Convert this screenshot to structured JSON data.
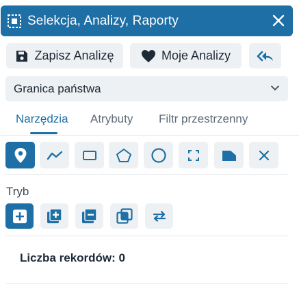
{
  "header": {
    "title": "Selekcja, Analizy, Raporty",
    "icon": "selection-frame-icon",
    "close_icon": "close-icon"
  },
  "actions": {
    "save_label": "Zapisz Analizę",
    "my_label": "Moje Analizy",
    "save_icon": "floppy-disk-icon",
    "my_icon": "heart-icon",
    "back_icon": "reply-all-icon"
  },
  "dropdown": {
    "value": "Granica państwa"
  },
  "tabs": [
    {
      "label": "Narzędzia",
      "active": true
    },
    {
      "label": "Atrybuty",
      "active": false
    },
    {
      "label": "Filtr przestrzenny",
      "active": false
    }
  ],
  "tools": [
    {
      "icon": "map-pin-icon",
      "active": true
    },
    {
      "icon": "polyline-icon",
      "active": false
    },
    {
      "icon": "rectangle-icon",
      "active": false
    },
    {
      "icon": "pentagon-icon",
      "active": false
    },
    {
      "icon": "circle-icon",
      "active": false
    },
    {
      "icon": "extent-icon",
      "active": false
    },
    {
      "icon": "area-shape-icon",
      "active": false
    },
    {
      "icon": "clear-icon",
      "active": false
    }
  ],
  "mode": {
    "label": "Tryb",
    "items": [
      {
        "icon": "new-selection-icon",
        "active": true
      },
      {
        "icon": "add-to-selection-icon",
        "active": false
      },
      {
        "icon": "remove-from-selection-icon",
        "active": false
      },
      {
        "icon": "intersect-selection-icon",
        "active": false
      },
      {
        "icon": "switch-selection-icon",
        "active": false
      }
    ]
  },
  "records": {
    "text": "Liczba rekordów: 0"
  },
  "colors": {
    "accent": "#1d6fa5",
    "button_bg": "#eef1f4",
    "text": "#1e2a36"
  }
}
